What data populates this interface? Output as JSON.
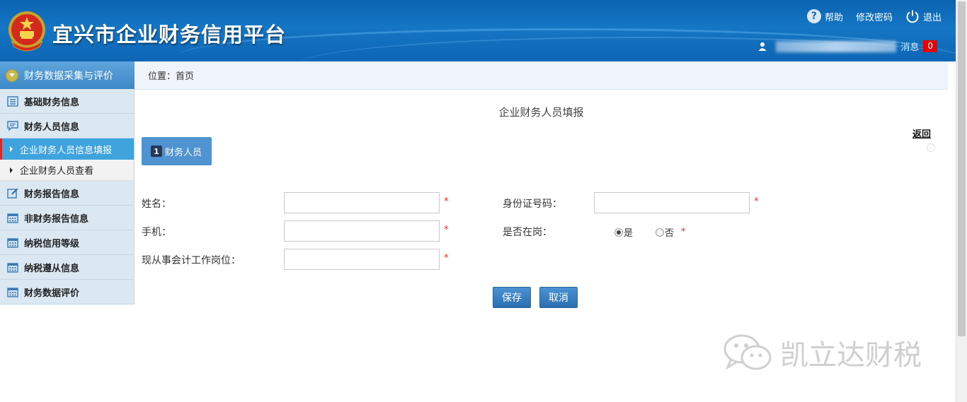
{
  "header": {
    "title": "宜兴市企业财务信用平台",
    "help_label": "帮助",
    "change_password_label": "修改密码",
    "logout_label": "退出",
    "messages_label": "消息",
    "messages_count": "0"
  },
  "sidebar": {
    "section_title": "财务数据采集与评价",
    "items": [
      {
        "label": "基础财务信息",
        "icon": "list-icon"
      },
      {
        "label": "财务人员信息",
        "icon": "comment-icon"
      },
      {
        "label": "财务报告信息",
        "icon": "edit-icon"
      },
      {
        "label": "非财务报告信息",
        "icon": "calendar-icon"
      },
      {
        "label": "纳税信用等级",
        "icon": "calendar-icon"
      },
      {
        "label": "纳税遵从信息",
        "icon": "calendar-icon"
      },
      {
        "label": "财务数据评价",
        "icon": "calendar-icon"
      }
    ],
    "subitems": [
      {
        "label": "企业财务人员信息填报",
        "active": true
      },
      {
        "label": "企业财务人员查看",
        "active": false
      }
    ]
  },
  "breadcrumb": "位置：首页",
  "form": {
    "title": "企业财务人员填报",
    "back_label": "返回",
    "step_number": "1",
    "step_label": "财务人员",
    "fields": {
      "name_label": "姓名：",
      "name_value": "",
      "id_label": "身份证号码：",
      "id_value": "",
      "phone_label": "手机：",
      "phone_value": "",
      "on_duty_label": "是否在岗：",
      "on_duty_yes": "是",
      "on_duty_no": "否",
      "on_duty_selected": "是",
      "position_label": "现从事会计工作岗位：",
      "position_value": ""
    },
    "required_mark": "*",
    "save_label": "保存",
    "cancel_label": "取消"
  },
  "watermark": "凯立达财税",
  "colors": {
    "header_blue": "#1576c4",
    "sidebar_bg": "#dbe8f2",
    "active_item": "#3fa3de",
    "button_blue": "#3a82c4",
    "badge_red": "#e60000",
    "required_red": "#e03030"
  }
}
